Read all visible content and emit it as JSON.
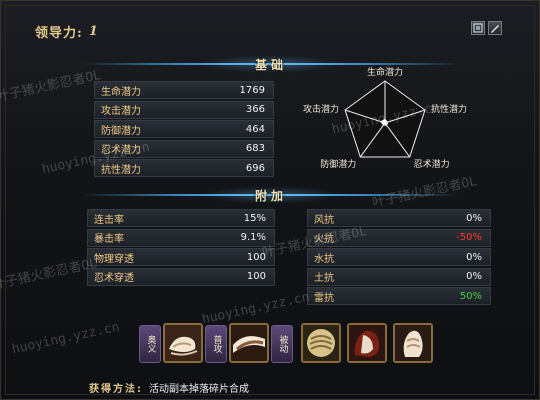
{
  "header": {
    "leader_label": "领导力:",
    "leader_value": "1"
  },
  "sections": {
    "base_title": "基础",
    "extra_title": "附加"
  },
  "base_stats": [
    {
      "name": "生命潜力",
      "value": "1769"
    },
    {
      "name": "攻击潜力",
      "value": "366"
    },
    {
      "name": "防御潜力",
      "value": "464"
    },
    {
      "name": "忍术潜力",
      "value": "683"
    },
    {
      "name": "抗性潜力",
      "value": "696"
    }
  ],
  "radar": {
    "labels": [
      "生命潜力",
      "抗性潜力",
      "忍术潜力",
      "防御潜力",
      "攻击潜力"
    ],
    "values": [
      0.1,
      0.08,
      0.08,
      0.07,
      0.12
    ],
    "fill_color": "#ffffff"
  },
  "extra_left": [
    {
      "name": "连击率",
      "value": "15%"
    },
    {
      "name": "暴击率",
      "value": "9.1%"
    },
    {
      "name": "物理穿透",
      "value": "100"
    },
    {
      "name": "忍术穿透",
      "value": "100"
    }
  ],
  "extra_right": [
    {
      "name": "风抗",
      "value": "0%",
      "color": "normal"
    },
    {
      "name": "火抗",
      "value": "-50%",
      "color": "red"
    },
    {
      "name": "水抗",
      "value": "0%",
      "color": "normal"
    },
    {
      "name": "土抗",
      "value": "0%",
      "color": "normal"
    },
    {
      "name": "雷抗",
      "value": "50%",
      "color": "green"
    }
  ],
  "skills": {
    "tag_ougi": "奥义",
    "tag_normal": "普攻",
    "tag_passive": "被动",
    "icons": [
      "ougi-skill-icon",
      "normal-attack-skill-icon",
      "passive-skill-1-icon",
      "passive-skill-2-icon",
      "passive-skill-3-icon"
    ]
  },
  "footer": {
    "label": "获得方法:",
    "value": "活动副本掉落碎片合成"
  },
  "watermark": {
    "text_cn": "叶子猪火影忍者OL",
    "text_url": "huoying.yzz.cn"
  },
  "colors": {
    "accent_gold": "#e2c88b",
    "stat_label": "#f0c985",
    "negative": "#ff3b30",
    "positive": "#4ecb4a",
    "section_glow": "#6ec6ff"
  }
}
